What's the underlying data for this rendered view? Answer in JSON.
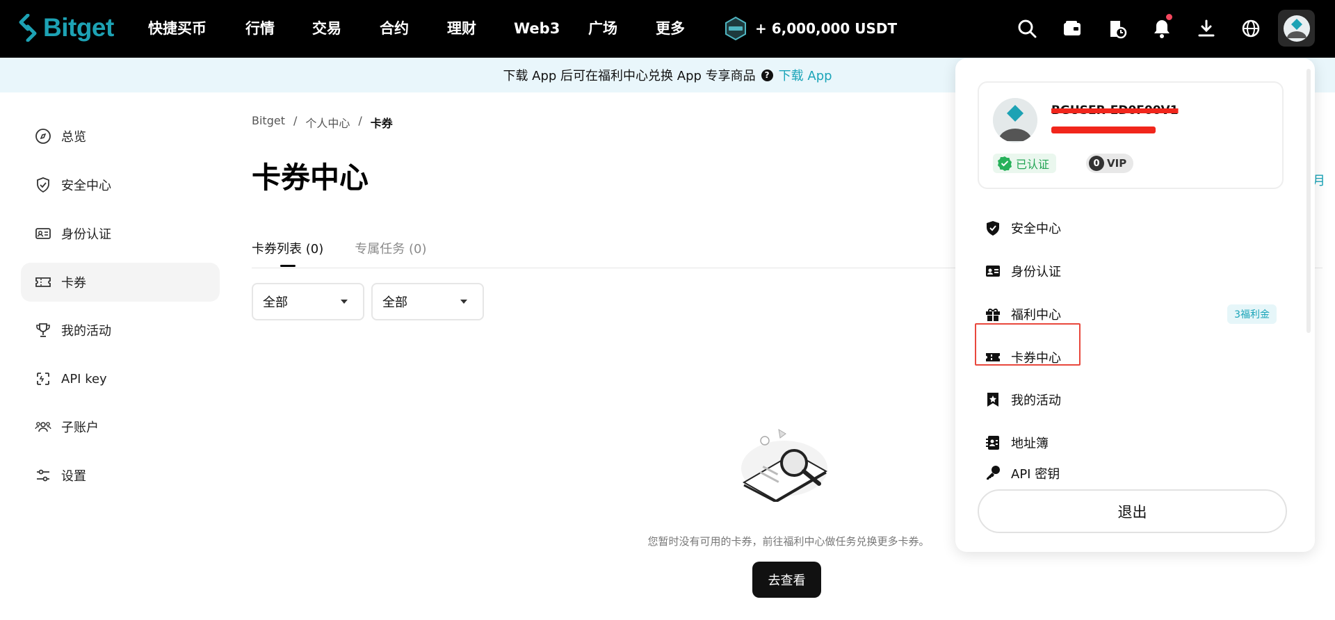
{
  "brand": {
    "name": "Bitget",
    "accent": "#1da2b4"
  },
  "nav": {
    "items": [
      "快捷买币",
      "行情",
      "交易",
      "合约",
      "理财",
      "Web3",
      "广场",
      "更多"
    ],
    "promo": "+ 6,000,000 USDT",
    "icons": [
      "search-icon",
      "wallet-icon",
      "order-history-icon",
      "notification-bell-icon",
      "download-icon",
      "globe-icon",
      "user-avatar-icon"
    ]
  },
  "banner": {
    "text": "下载 App 后可在福利中心兑换 App 专享商品",
    "link": "下载 App"
  },
  "sidebar": {
    "items": [
      {
        "label": "总览",
        "icon": "compass-icon"
      },
      {
        "label": "安全中心",
        "icon": "shield-icon"
      },
      {
        "label": "身份认证",
        "icon": "id-card-icon"
      },
      {
        "label": "卡券",
        "icon": "ticket-icon",
        "active": true
      },
      {
        "label": "我的活动",
        "icon": "trophy-icon"
      },
      {
        "label": "API key",
        "icon": "api-key-icon"
      },
      {
        "label": "子账户",
        "icon": "sub-accounts-icon"
      },
      {
        "label": "设置",
        "icon": "settings-sliders-icon"
      }
    ]
  },
  "breadcrumb": {
    "root": "Bitget",
    "sep": "/",
    "parent": "个人中心",
    "current": "卡券"
  },
  "main": {
    "title": "卡券中心",
    "tabs": [
      {
        "label": "卡券列表",
        "count": "(0)",
        "active": true
      },
      {
        "label": "专属任务",
        "count": "(0)",
        "active": false
      }
    ],
    "filters": [
      {
        "value": "全部"
      },
      {
        "value": "全部"
      }
    ],
    "empty_text": "您暂时没有可用的卡券，前往福利中心做任务兑换更多卡券。",
    "empty_button": "去查看",
    "peek_char": "月"
  },
  "dropdown": {
    "username": "BGUSER-ED0F00V1",
    "verified": "已认证",
    "vip_level": "0",
    "vip_label": "VIP",
    "items": [
      {
        "label": "安全中心",
        "icon": "shield-check-icon"
      },
      {
        "label": "身份认证",
        "icon": "id-card-icon"
      },
      {
        "label": "福利中心",
        "icon": "gift-icon",
        "badge": "3福利金"
      },
      {
        "label": "卡券中心",
        "icon": "ticket-icon",
        "highlighted": true
      },
      {
        "label": "我的活动",
        "icon": "bookmark-star-icon"
      },
      {
        "label": "地址簿",
        "icon": "address-book-icon"
      },
      {
        "label": "API 密钥",
        "icon": "api-key-icon"
      }
    ],
    "logout": "退出"
  }
}
